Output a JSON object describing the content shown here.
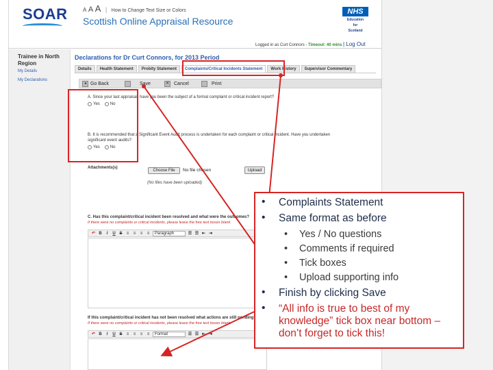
{
  "header": {
    "logo_text": "SOAR",
    "text_size_a1": "A",
    "text_size_a2": "A",
    "text_size_a3": "A",
    "text_size_link": "How to Change Text Size or Colors",
    "app_title": "Scottish Online Appraisal Resource",
    "nhs_logo": "NHS",
    "nhs_sub_1": "Education",
    "nhs_sub_2": "for",
    "nhs_sub_3": "Scotland",
    "logged_in_as": "Logged in as Curt Connors -",
    "timeout": "Timeout: 40 mins",
    "logout": "| Log Out"
  },
  "sidebar": {
    "title": "Trainee in North Region",
    "items": [
      {
        "label": "My Details"
      },
      {
        "label": "My Declarations"
      }
    ]
  },
  "main": {
    "page_title": "Declarations for Dr  Curt Connors, for 2013 Period",
    "tabs": [
      {
        "label": "Details"
      },
      {
        "label": "Health Statement"
      },
      {
        "label": "Probity Statement"
      },
      {
        "label": "Complaints/Critical Incidents Statement"
      },
      {
        "label": "Work History"
      },
      {
        "label": "Supervisor Commentary"
      }
    ],
    "toolbar": {
      "go_back": "Go Back",
      "save": "Save",
      "cancel": "Cancel",
      "print": "Print"
    },
    "question_a": "A. Since your last appraisal, have you been the subject of a formal complaint or critical incident report?",
    "question_b_1": "B. It is recommended that a Significant Event Audit process is undertaken for each complaint or critical incident. Have you undertaken",
    "question_b_2": "significant event audits?",
    "yes": "Yes",
    "no": "No",
    "attachments_label": "Attachments(s)",
    "choose_file": "Choose File",
    "no_file_chosen": "No file chosen",
    "upload": "Upload",
    "no_files_note": "(No files have been uploaded)",
    "question_c": "C. Has this complaint/critical incident been resolved and what were the outcomes?",
    "question_c_note": "If there were no complaints or critical incidents, please leave the free text boxes blank.",
    "editor_format_1": "Paragraph",
    "question_d": "If this complaint/critical incident has not been resolved what actions are still pending?",
    "question_d_note": "If there were no complaints or critical incidents, please leave the free text boxes blank.",
    "editor_format_2": "Format"
  },
  "callout": {
    "bullets": [
      "Complaints Statement",
      "Same format as before"
    ],
    "sub_bullets": [
      "Yes / No questions",
      "Comments if required",
      "Tick boxes",
      "Upload supporting info"
    ],
    "finish": "Finish by clicking Save",
    "tick_note": "“All info is true to best of my knowledge” tick box near bottom – don’t forget to tick this!"
  },
  "colors": {
    "brand_blue": "#2a6fb8",
    "nhs_blue": "#005eb8",
    "annotation_red": "#d62424"
  }
}
